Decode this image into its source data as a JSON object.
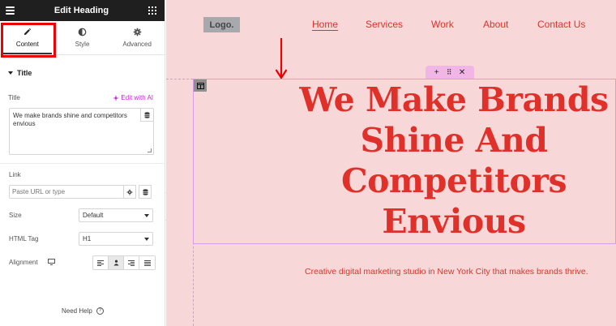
{
  "panel": {
    "title": "Edit Heading",
    "tabs": [
      {
        "label": "Content",
        "icon": "pencil-icon",
        "active": true
      },
      {
        "label": "Style",
        "icon": "half-circle-icon",
        "active": false
      },
      {
        "label": "Advanced",
        "icon": "gear-icon",
        "active": false
      }
    ],
    "section_title": "Title",
    "title_label": "Title",
    "ai_label": "Edit with AI",
    "title_value": "We make brands shine and competitors envious",
    "link_label": "Link",
    "link_placeholder": "Paste URL or type",
    "size_label": "Size",
    "size_value": "Default",
    "html_tag_label": "HTML Tag",
    "html_tag_value": "H1",
    "alignment_label": "Alignment",
    "alignment_active": "center",
    "help_label": "Need Help"
  },
  "canvas": {
    "logo": "Logo.",
    "nav": [
      "Home",
      "Services",
      "Work",
      "About",
      "Contact Us"
    ],
    "active_nav": "Home",
    "heading_lines": [
      "We Make Brands",
      "Shine And",
      "Competitors",
      "Envious"
    ],
    "subtitle": "Creative digital marketing studio in New York City that makes brands thrive."
  },
  "colors": {
    "accent": "#e0302a",
    "canvas_bg": "#f8d7d9",
    "panel_topbar": "#1f1f1f",
    "ai_link": "#c026d3",
    "selection": "#d79be8",
    "highlight": "#ee0000"
  }
}
